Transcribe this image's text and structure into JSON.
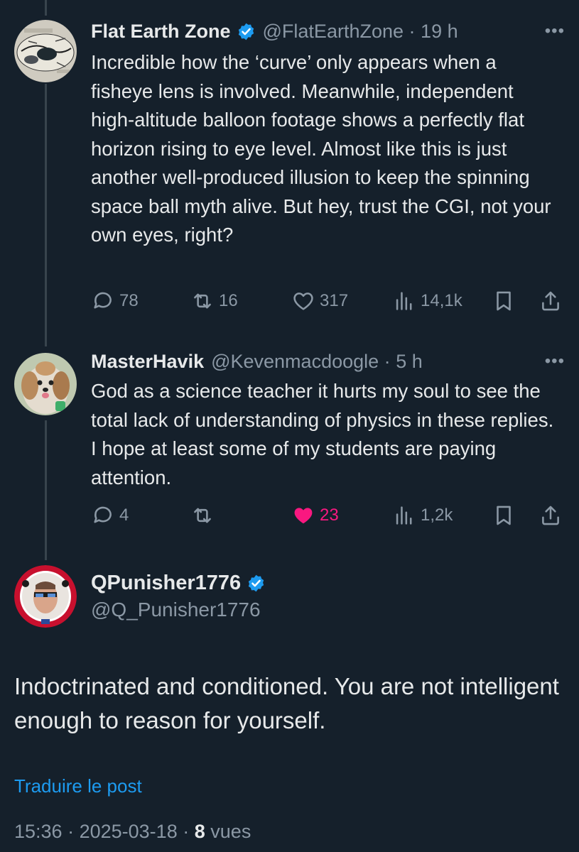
{
  "tweets": [
    {
      "display_name": "Flat Earth Zone",
      "verified": true,
      "handle": "@FlatEarthZone",
      "time": "19 h",
      "text": "Incredible how the ‘curve’ only appears when a fisheye lens is involved. Meanwhile, independent high-altitude balloon footage shows a perfectly flat horizon rising to eye level. Almost like this is just another well-produced illusion to keep the spinning space ball myth alive. But hey, trust the CGI, not your own eyes, right?",
      "actions": {
        "replies": "78",
        "reposts": "16",
        "likes": "317",
        "views": "14,1k"
      },
      "liked": false
    },
    {
      "display_name": "MasterHavik",
      "verified": false,
      "handle": "@Kevenmacdoogle",
      "time": "5 h",
      "text": "God as a science teacher it hurts my soul to see the total lack of understanding of physics in these replies. I hope at least some of my students are paying attention.",
      "actions": {
        "replies": "4",
        "reposts": "",
        "likes": "23",
        "views": "1,2k"
      },
      "liked": true
    }
  ],
  "main_post": {
    "display_name": "QPunisher1776",
    "verified": true,
    "handle": "@Q_Punisher1776",
    "text": "Indoctrinated and conditioned. You are not intelligent enough to reason for yourself.",
    "translate_label": "Traduire le post",
    "time": "15:36",
    "date": "2025-03-18",
    "views_count": "8",
    "views_label": "vues"
  },
  "icons": {
    "reply": "reply-icon",
    "repost": "repost-icon",
    "like": "heart-icon",
    "views": "views-icon",
    "bookmark": "bookmark-icon",
    "share": "share-icon",
    "more": "more-icon",
    "verified": "verified-badge-icon"
  },
  "colors": {
    "background": "#15202b",
    "text": "#e7e9ea",
    "muted": "#8b98a5",
    "accent": "#1d9bf0",
    "like": "#f91880",
    "thread_line": "#38444d"
  }
}
